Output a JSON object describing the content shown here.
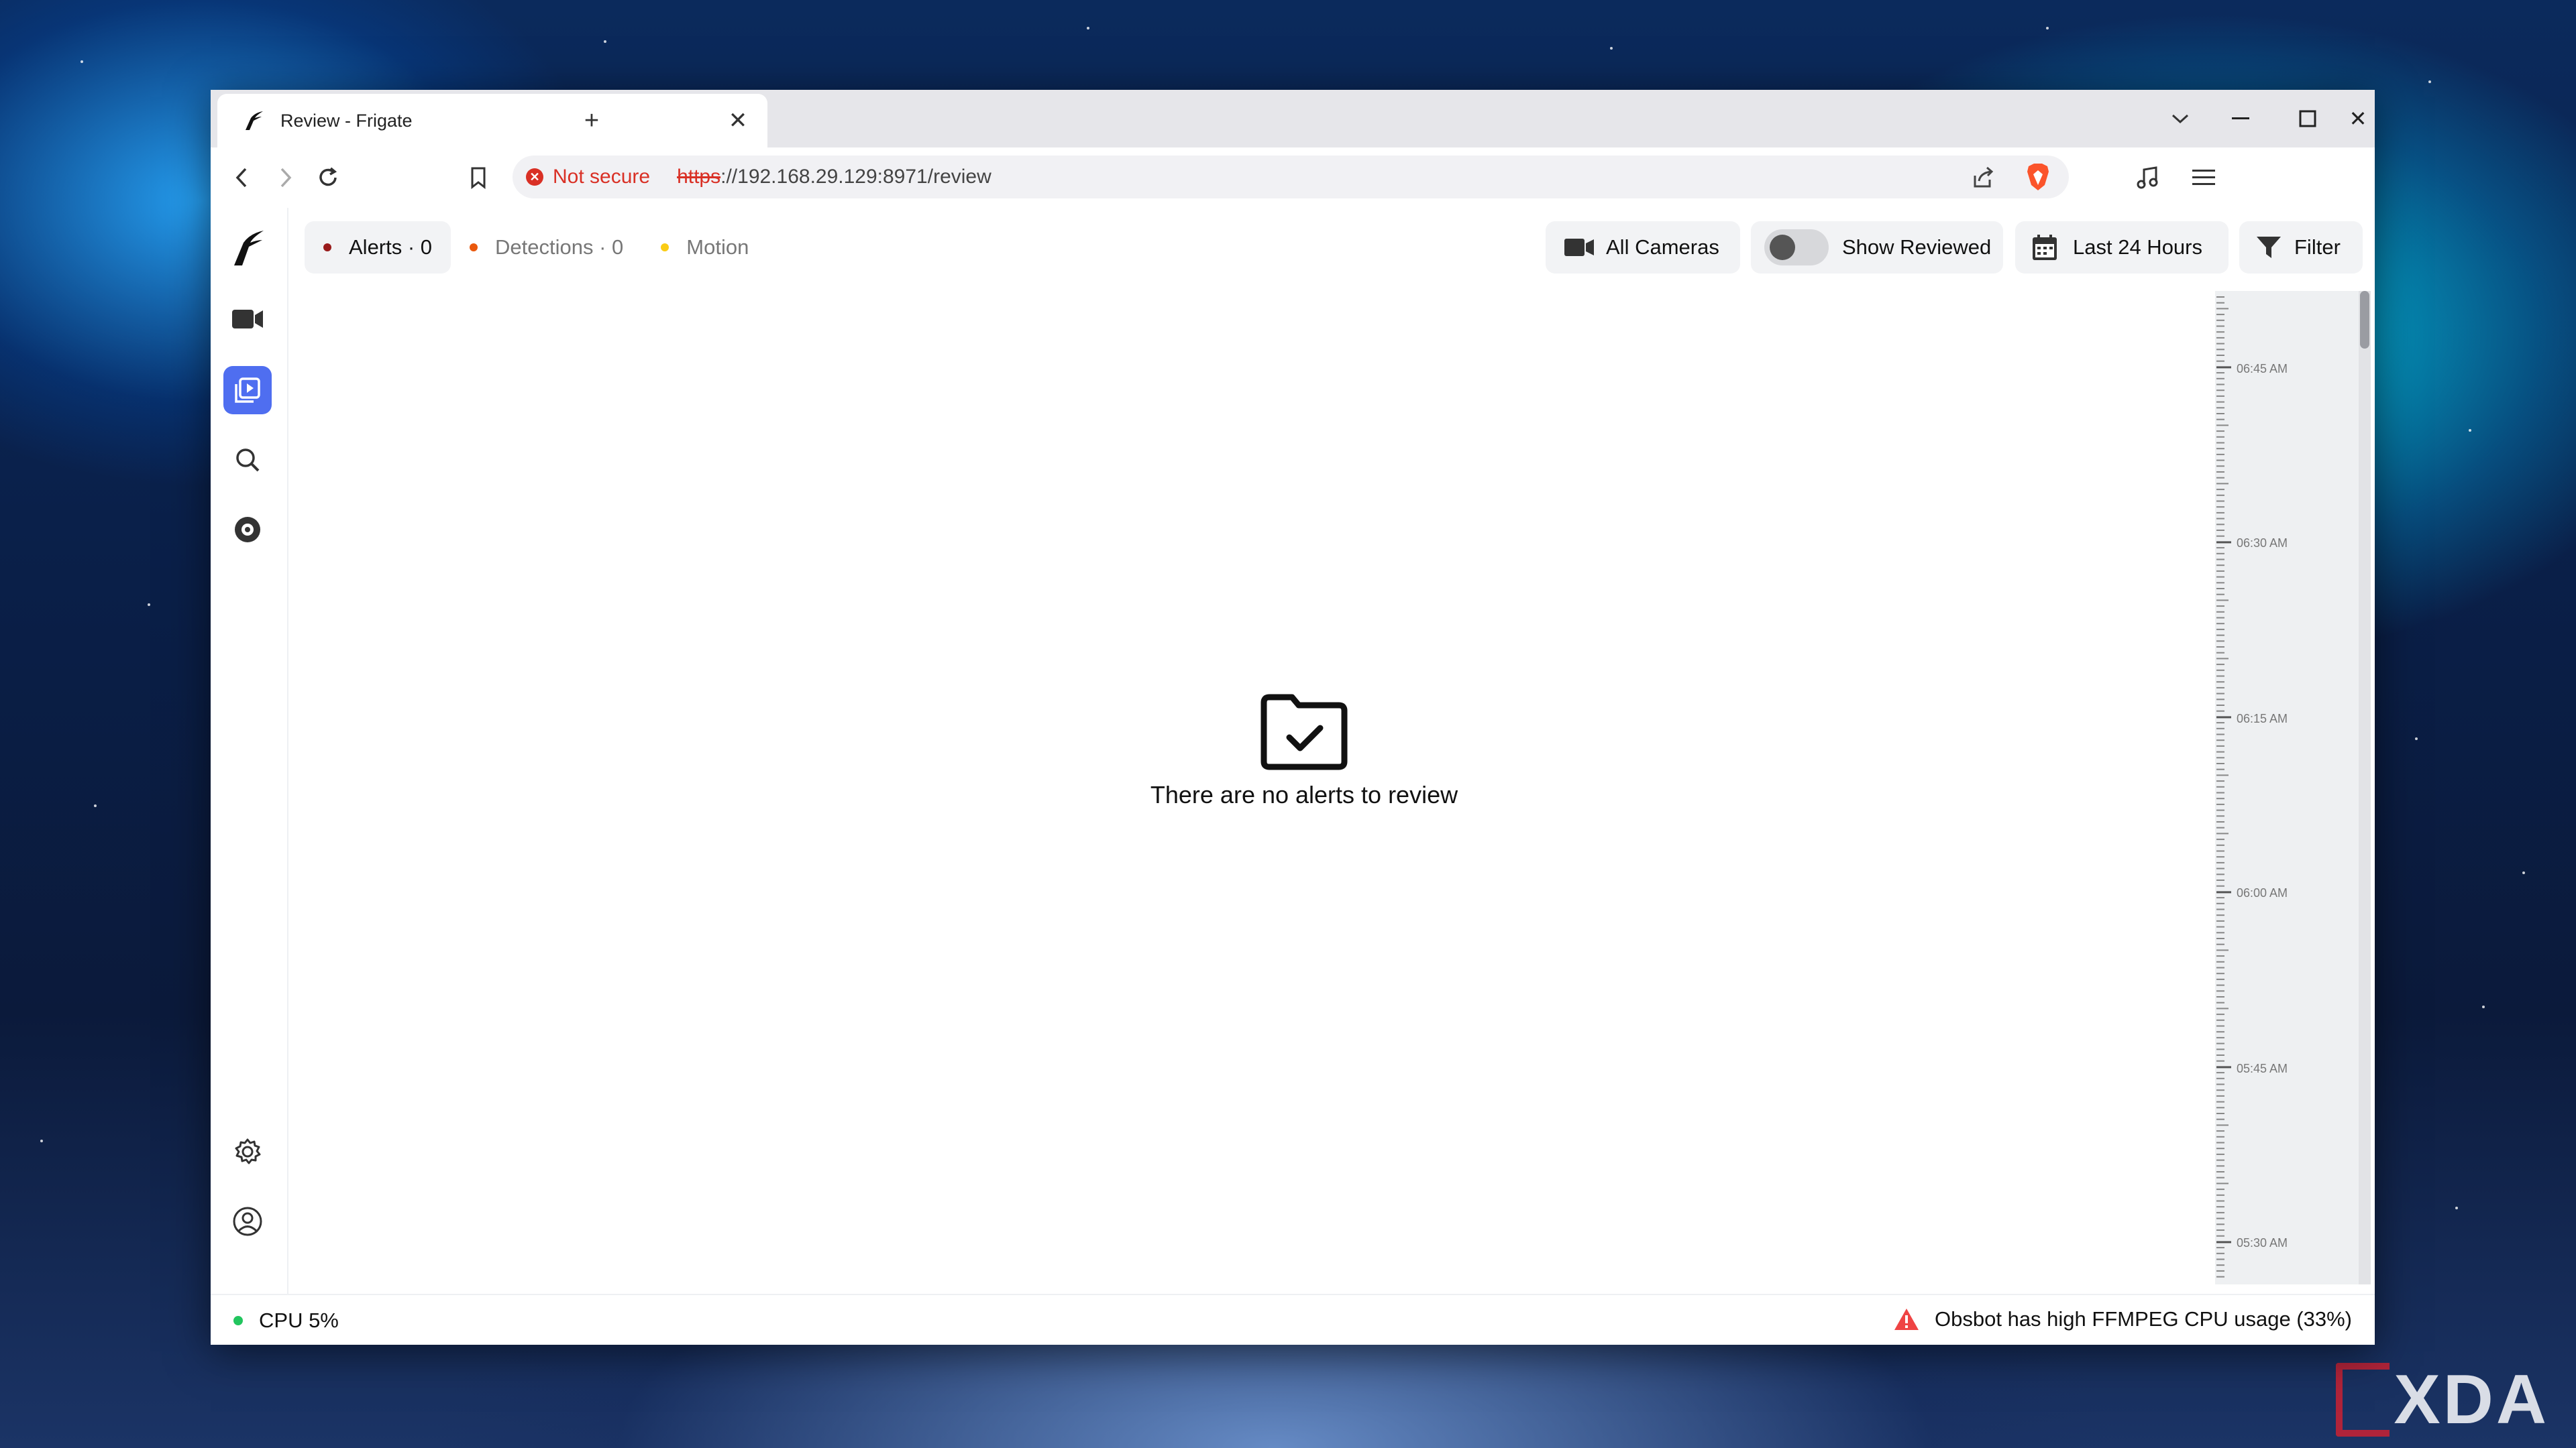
{
  "browser": {
    "tab_title": "Review - Frigate",
    "not_secure_label": "Not secure",
    "url_scheme": "https",
    "url_rest": "://192.168.29.129:8971/review"
  },
  "filters": {
    "alerts": "Alerts · 0",
    "detections": "Detections · 0",
    "motion": "Motion",
    "colors": {
      "alerts": "#991b1b",
      "detections": "#ea580c",
      "motion": "#facc15"
    }
  },
  "controls": {
    "cameras": "All Cameras",
    "show_reviewed": "Show Reviewed",
    "show_reviewed_on": false,
    "time_range": "Last 24 Hours",
    "filter": "Filter"
  },
  "empty_state": {
    "message": "There are no alerts to review"
  },
  "timeline": {
    "labels": [
      "06:45 AM",
      "06:30 AM",
      "06:15 AM",
      "06:00 AM",
      "05:45 AM",
      "05:30 AM"
    ]
  },
  "status": {
    "cpu": "CPU 5%",
    "warning": "Obsbot has high FFMPEG CPU usage (33%)"
  },
  "watermark": "XDA"
}
